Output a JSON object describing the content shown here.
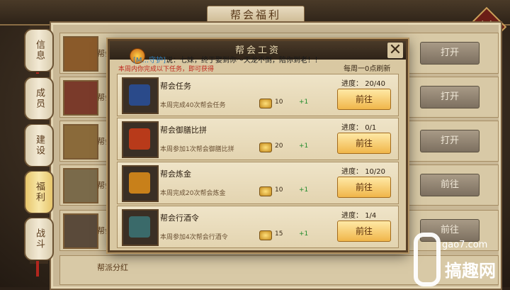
{
  "window": {
    "title": "帮会福利",
    "close_icon": "close-x-icon"
  },
  "side_nav": [
    {
      "label": "信息",
      "active": false
    },
    {
      "label": "成员",
      "active": false
    },
    {
      "label": "建设",
      "active": false
    },
    {
      "label": "福利",
      "active": true
    },
    {
      "label": "战斗",
      "active": false
    }
  ],
  "background_rows": [
    {
      "snippet": "帮会",
      "button": "打开",
      "thumb_color": "#8a5a2a"
    },
    {
      "snippet": "帮会\n可在",
      "button": "打开",
      "thumb_color": "#7a3a2a"
    },
    {
      "snippet": "帮会\n完成",
      "button": "打开",
      "thumb_color": "#8a6a3a"
    },
    {
      "snippet": "帮会\n收取",
      "button": "前往",
      "thumb_color": "#7a6a4a"
    },
    {
      "snippet": "帮会\n帮主",
      "button": "前往",
      "thumb_color": "#5a4a3a"
    },
    {
      "snippet": "帮派分红",
      "button": "",
      "thumb_color": "#6a5a4a"
    }
  ],
  "modal": {
    "title": "帮会工资",
    "notice": "本周内你完成以下任务，即可获得",
    "refresh_text": "每周一0点刷新",
    "close_icon": "close-x-icon"
  },
  "chat": {
    "speaker": "[M...守护]",
    "text": "说：七妹，终于娶到你～天龙不倒，陪你到老！！"
  },
  "tasks": [
    {
      "name": "帮会任务",
      "desc": "本周完成40次帮会任务",
      "reward": "10",
      "bonus": "+1",
      "progress_label": "进度：",
      "progress": "20/40",
      "button": "前往",
      "icon_color": "#2a4a8a"
    },
    {
      "name": "帮会御膳比拼",
      "desc": "本周参加1次帮会御膳比拼",
      "reward": "20",
      "bonus": "+1",
      "progress_label": "进度：",
      "progress": "0/1",
      "button": "前往",
      "icon_color": "#b83a1a"
    },
    {
      "name": "帮会炼金",
      "desc": "本周完成20次帮会炼金",
      "reward": "10",
      "bonus": "+1",
      "progress_label": "进度：",
      "progress": "10/20",
      "button": "前往",
      "icon_color": "#c8801a"
    },
    {
      "name": "帮会行酒令",
      "desc": "本周参加4次帮会行酒令",
      "reward": "15",
      "bonus": "+1",
      "progress_label": "进度：",
      "progress": "1/4",
      "button": "前往",
      "icon_color": "#3a6a6a"
    }
  ],
  "watermark": {
    "site": "gao7.com",
    "brand": "搞趣网"
  }
}
